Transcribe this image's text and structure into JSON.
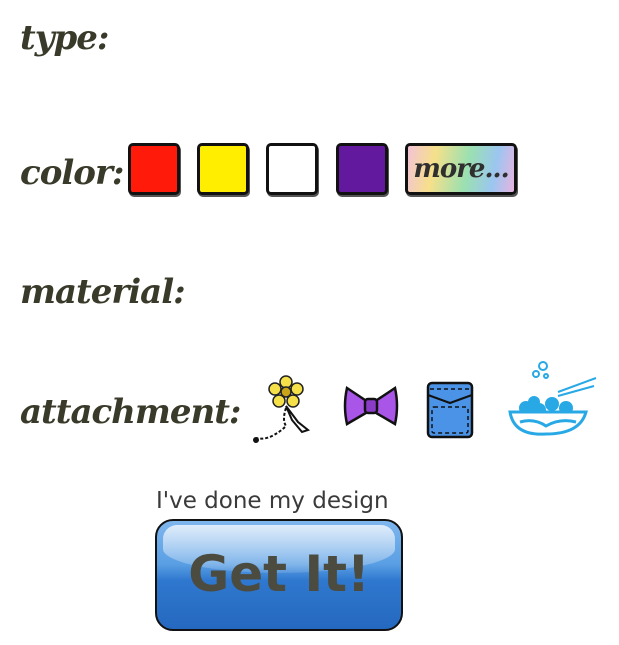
{
  "labels": {
    "type": "type:",
    "color": "color:",
    "material": "material:",
    "attachment": "attachment:"
  },
  "colors": [
    {
      "name": "red",
      "hex": "#ff1a0a"
    },
    {
      "name": "yellow",
      "hex": "#ffee00"
    },
    {
      "name": "white",
      "hex": "#ffffff"
    },
    {
      "name": "purple",
      "hex": "#63199e"
    }
  ],
  "more_label": "more...",
  "attachments": [
    {
      "icon": "flower-charm-icon",
      "color": "#f5e04a"
    },
    {
      "icon": "bow-icon",
      "color": "#a855e8"
    },
    {
      "icon": "pocket-icon",
      "color": "#4b93e6"
    },
    {
      "icon": "bubble-bowl-icon",
      "color": "#28a9e6"
    }
  ],
  "done_text": "I've done my design",
  "button_label": "Get It!"
}
